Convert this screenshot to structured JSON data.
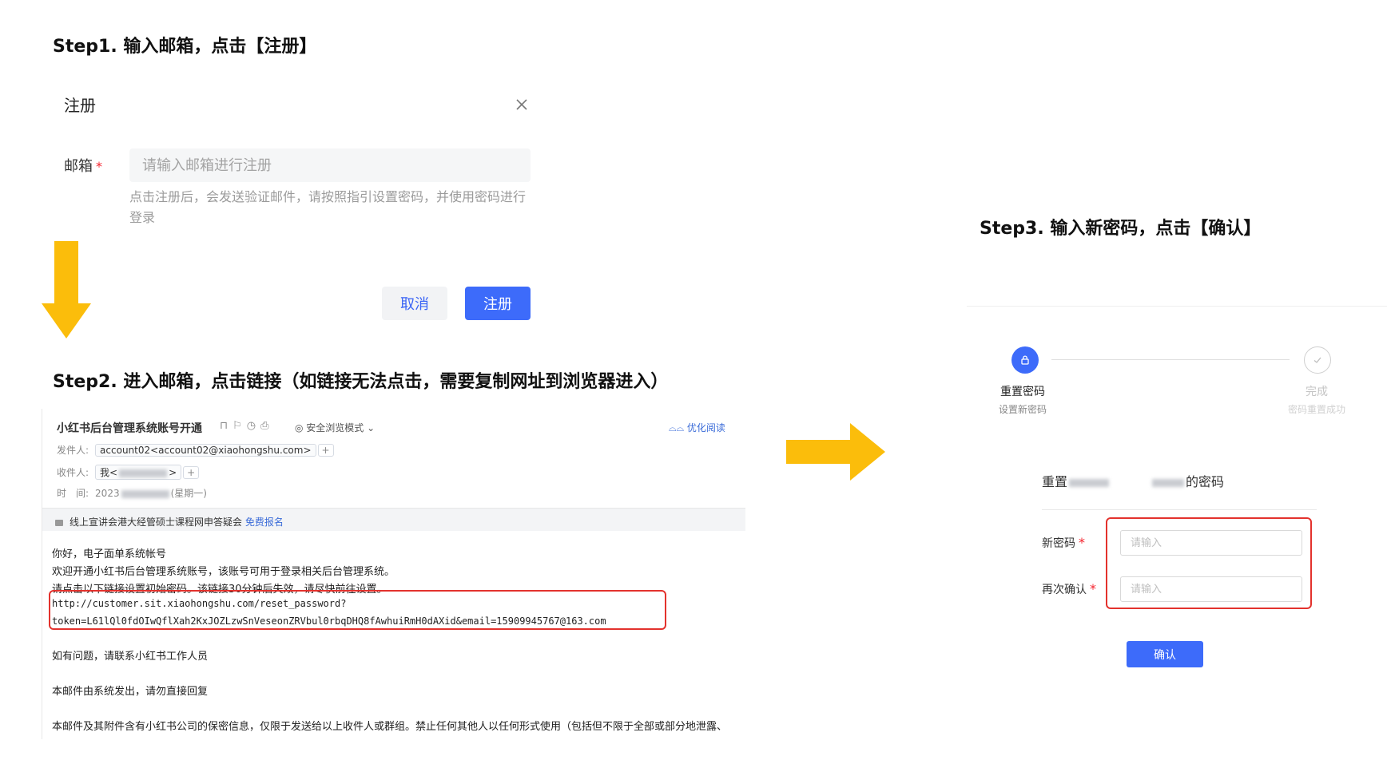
{
  "steps": {
    "step1_title": "Step1. 输入邮箱，点击【注册】",
    "step2_title": "Step2. 进入邮箱，点击链接（如链接无法点击，需要复制网址到浏览器进入）",
    "step3_title": "Step3. 输入新密码，点击【确认】"
  },
  "register_dialog": {
    "title": "注册",
    "email_label": "邮箱",
    "required_mark": "*",
    "email_placeholder": "请输入邮箱进行注册",
    "hint": "点击注册后，会发送验证邮件，请按照指引设置密码，并使用密码进行登录",
    "cancel_label": "取消",
    "register_label": "注册"
  },
  "email": {
    "subject": "小红书后台管理系统账号开通",
    "toolbar_icons": "⊓⚐◷⎙",
    "safe_mode": "安全浏览模式",
    "optimize_read": "优化阅读",
    "from_label": "发件人:",
    "from_value": "account02<account02@xiaohongshu.com>",
    "to_label": "收件人:",
    "to_prefix": "我<",
    "to_suffix": ">",
    "time_label": "时　间:",
    "time_value": "2023",
    "time_suffix": "(星期一)",
    "banner_text": "线上宣讲会港大经管硕士课程网申答疑会",
    "banner_link": "免费报名",
    "greeting": "你好，电子面单系统帐号",
    "line1": "欢迎开通小红书后台管理系统账号，该账号可用于登录相关后台管理系统。",
    "line2": "请点击以下链接设置初始密码。该链接30分钟后失效，请尽快前往设置。",
    "url_line1": "http://customer.sit.xiaohongshu.com/reset_password?",
    "url_line2": "token=L61lQl0fdOIwQflXah2KxJOZLzwSnVeseonZRVbul0rbqDHQ8fAwhuiRmH0dAXid&email=15909945767@163.com",
    "contact": "如有问题，请联系小红书工作人员",
    "system_note": "本邮件由系统发出，请勿直接回复",
    "disclaimer": "本邮件及其附件含有小红书公司的保密信息，仅限于发送给以上收件人或群组。禁止任何其他人以任何形式使用（包括但不限于全部或部分地泄露、"
  },
  "reset_panel": {
    "step1_label": "重置密码",
    "step1_sub": "设置新密码",
    "step2_label": "完成",
    "step2_sub": "密码重置成功",
    "title_prefix": "重置",
    "title_suffix": "的密码",
    "new_pwd_label": "新密码",
    "confirm_pwd_label": "再次确认",
    "required_mark": "*",
    "placeholder": "请输入",
    "confirm_label": "确认"
  },
  "colors": {
    "accent": "#3d6bfa",
    "arrow": "#fbbd0b",
    "highlight": "#e3322d"
  }
}
